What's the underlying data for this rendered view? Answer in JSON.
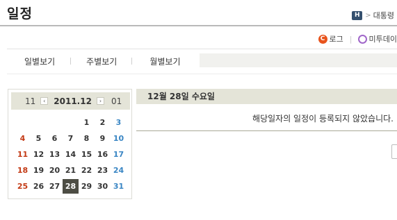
{
  "page": {
    "title": "일정"
  },
  "breadcrumb": {
    "home_label": "H",
    "separator": ">",
    "current": "대통령"
  },
  "share": {
    "items": [
      {
        "label": "로그",
        "icon": "c-log-icon",
        "icon_text": "C"
      },
      {
        "label": "미투데이",
        "icon": "me2day-icon"
      }
    ],
    "separator": "|"
  },
  "tabs": [
    {
      "label": "일별보기"
    },
    {
      "label": "주별보기"
    },
    {
      "label": "월별보기"
    }
  ],
  "calendar": {
    "prev_month": "11",
    "current": "2011.12",
    "next_month": "01",
    "prev_arrow": "‹",
    "next_arrow": "›",
    "weeks": [
      [
        "",
        "",
        "",
        "",
        "1",
        "2",
        "3"
      ],
      [
        "4",
        "5",
        "6",
        "7",
        "8",
        "9",
        "10"
      ],
      [
        "11",
        "12",
        "13",
        "14",
        "15",
        "16",
        "17"
      ],
      [
        "18",
        "19",
        "20",
        "21",
        "22",
        "23",
        "24"
      ],
      [
        "25",
        "26",
        "27",
        "28",
        "29",
        "30",
        "31"
      ]
    ],
    "selected_day": "28"
  },
  "content": {
    "date_heading": "12월 28일 수요일",
    "empty_message": "해당일자의 일정이 등록되지 않았습니다."
  },
  "colors": {
    "sunday": "#c33a15",
    "saturday": "#3a86c4",
    "header_bg": "#e4e4d8",
    "selected_bg": "#4d4d44"
  }
}
